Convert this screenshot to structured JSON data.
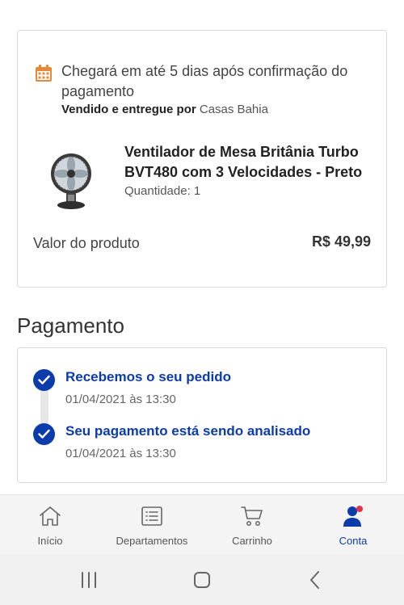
{
  "order": {
    "delivery_text": "Chegará em até 5 dias após confirmação do pagamento",
    "seller_prefix": "Vendido e entregue por",
    "seller_name": "Casas Bahia",
    "product": {
      "name_line1": "Ventilador de Mesa Britânia Turbo",
      "name_line2": "BVT480 com 3 Velocidades - Preto",
      "quantity": "Quantidade: 1"
    },
    "value_label": "Valor do produto",
    "value_amount": "R$ 49,99"
  },
  "payment": {
    "title": "Pagamento",
    "steps": [
      {
        "title": "Recebemos o seu pedido",
        "date": "01/04/2021 às 13:30"
      },
      {
        "title": "Seu pagamento está sendo analisado",
        "date": "01/04/2021 às 13:30"
      }
    ]
  },
  "nav": {
    "items": [
      {
        "label": "Início",
        "icon": "home-icon"
      },
      {
        "label": "Departamentos",
        "icon": "list-icon"
      },
      {
        "label": "Carrinho",
        "icon": "cart-icon"
      },
      {
        "label": "Conta",
        "icon": "user-icon",
        "active": true
      }
    ]
  },
  "colors": {
    "accent": "#0c3bac",
    "calendar": "#e8893a",
    "notification_dot": "#e0344b"
  }
}
